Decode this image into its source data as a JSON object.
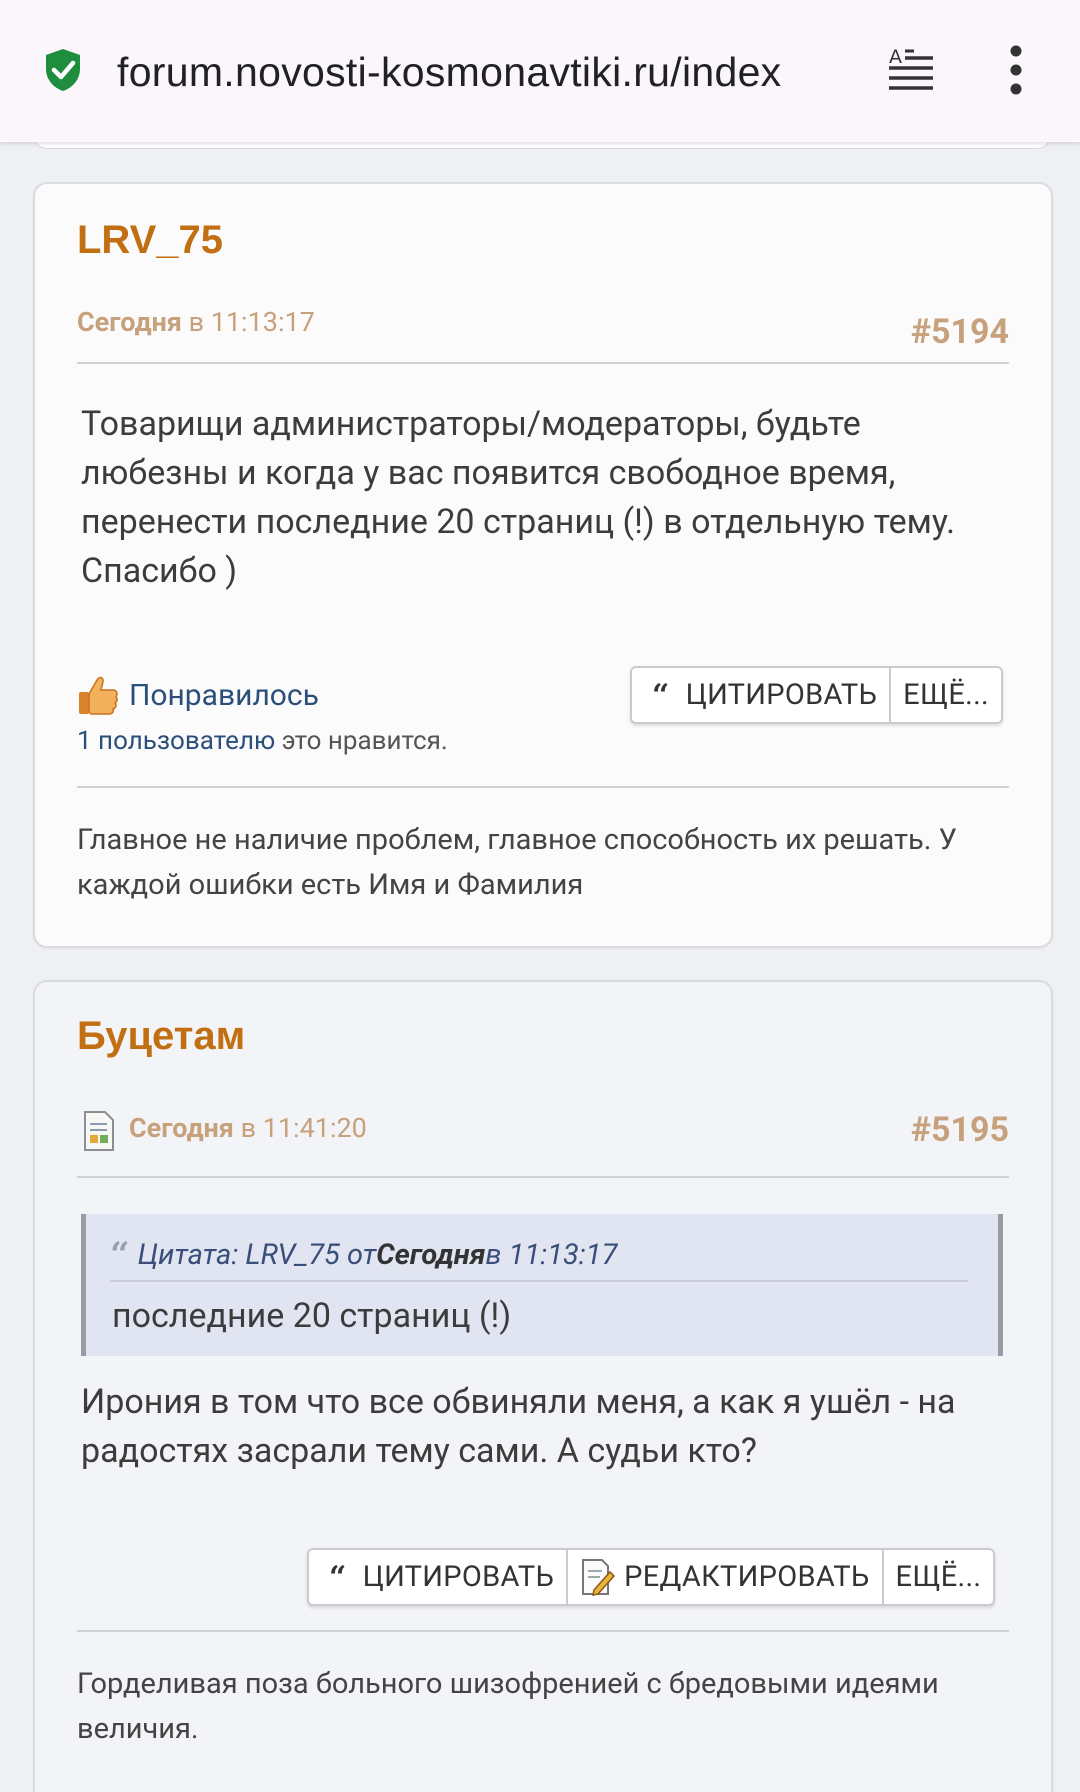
{
  "browser": {
    "url": "forum.novosti-kosmonavtiki.ru/index"
  },
  "posts": [
    {
      "author": "LRV_75",
      "date_day": "Сегодня",
      "date_time": "в 11:13:17",
      "number": "#5194",
      "body": "Товарищи администраторы/модераторы, будьте любезны и когда у вас появится свободное время, перенести последние 20 страниц (!) в отдельную тему. Спасибо )",
      "like_label": "Понравилось",
      "like_count_link": "1 пользователю",
      "like_count_text": " это нравится.",
      "buttons": {
        "quote": "ЦИТИРОВАТЬ",
        "more": "ЕЩЁ..."
      },
      "signature": "Главное не наличие проблем, главное способность их решать. У каждой ошибки есть Имя и Фамилия"
    },
    {
      "author": "Буцетам",
      "date_day": "Сегодня",
      "date_time": "в 11:41:20",
      "number": "#5195",
      "quote": {
        "prefix": "Цитата: LRV_75 от ",
        "day": "Сегодня",
        "time": " в 11:13:17",
        "text": "последние 20 страниц (!)"
      },
      "body": "Ирония в том что все обвиняли меня, а как я ушёл - на радостях засрали тему сами. А судьи кто?",
      "buttons": {
        "quote": "ЦИТИРОВАТЬ",
        "edit": "РЕДАКТИРОВАТЬ",
        "more": "ЕЩЁ..."
      },
      "signature": "Горделивая поза больного шизофренией с бредовыми идеями величия."
    }
  ]
}
